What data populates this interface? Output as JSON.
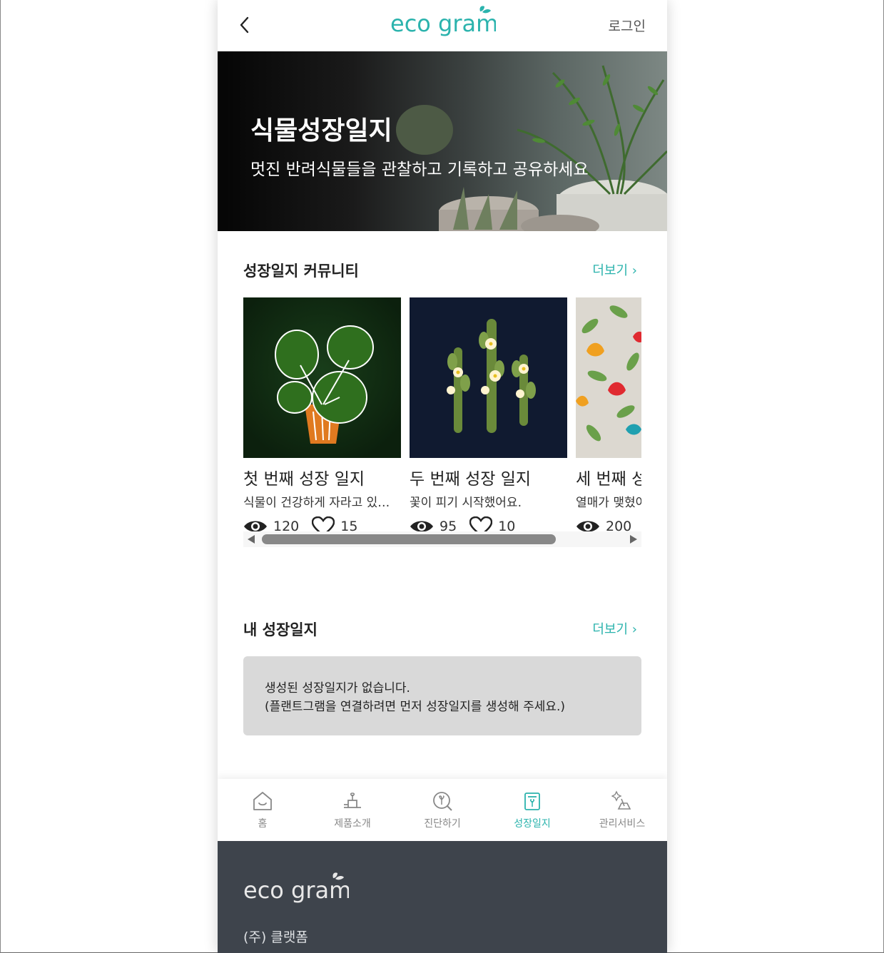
{
  "header": {
    "logo_text": "eco gram",
    "login_label": "로그인"
  },
  "hero": {
    "title": "식물성장일지",
    "subtitle": "멋진 반려식물들을 관찰하고 기록하고 공유하세요"
  },
  "community": {
    "title": "성장일지 커뮤니티",
    "more_label": "더보기 ›",
    "cards": [
      {
        "title": "첫 번째 성장 일지",
        "desc": "식물이 건강하게 자라고 있어요.",
        "views": "120",
        "likes": "15"
      },
      {
        "title": "두 번째 성장 일지",
        "desc": "꽃이 피기 시작했어요.",
        "views": "95",
        "likes": "10"
      },
      {
        "title": "세 번째 성장 일지",
        "desc": "열매가 맺혔어요.",
        "views": "200",
        "likes": ""
      }
    ]
  },
  "my_journal": {
    "title": "내 성장일지",
    "more_label": "더보기 ›",
    "empty_line1": "생성된 성장일지가 없습니다.",
    "empty_line2": "(플랜트그램을 연결하려면 먼저 성장일지를 생성해 주세요.)"
  },
  "bottom_nav": {
    "items": [
      {
        "label": "홈",
        "icon": "home-icon"
      },
      {
        "label": "제품소개",
        "icon": "product-icon"
      },
      {
        "label": "진단하기",
        "icon": "diagnose-icon"
      },
      {
        "label": "성장일지",
        "icon": "journal-icon",
        "active": true
      },
      {
        "label": "관리서비스",
        "icon": "care-service-icon"
      }
    ]
  },
  "footer": {
    "logo_text": "eco gram",
    "company": "(주) 클랫폼"
  },
  "colors": {
    "accent": "#2bb3ad",
    "footer_bg": "#3e444c",
    "empty_box_bg": "#d9d9d9"
  }
}
